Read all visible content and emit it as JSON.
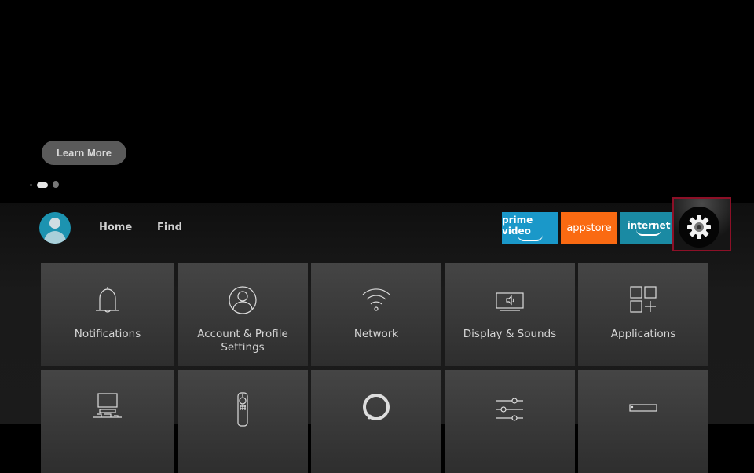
{
  "hero": {
    "learn_more_label": "Learn More",
    "carousel": {
      "pages": 2,
      "active_index": 0
    }
  },
  "nav": {
    "profile_icon": "profile-avatar",
    "items": [
      {
        "label": "Home"
      },
      {
        "label": "Find"
      }
    ]
  },
  "apps": [
    {
      "label": "prime video",
      "color": "#1a98c9"
    },
    {
      "label": "appstore",
      "color": "#fa6a12"
    },
    {
      "label": "internet",
      "color": "#1a8aa3"
    }
  ],
  "settings": {
    "icon": "gear-icon",
    "highlight_color": "#8c1027"
  },
  "tiles": [
    {
      "label": "Notifications",
      "icon": "bell-icon"
    },
    {
      "label": "Account & Profile Settings",
      "icon": "account-icon"
    },
    {
      "label": "Network",
      "icon": "wifi-icon"
    },
    {
      "label": "Display & Sounds",
      "icon": "tv-speaker-icon"
    },
    {
      "label": "Applications",
      "icon": "apps-icon"
    },
    {
      "label": "",
      "icon": "equipment-control-icon"
    },
    {
      "label": "",
      "icon": "remote-icon"
    },
    {
      "label": "",
      "icon": "alexa-icon"
    },
    {
      "label": "",
      "icon": "preferences-sliders-icon"
    },
    {
      "label": "",
      "icon": "device-icon"
    }
  ]
}
